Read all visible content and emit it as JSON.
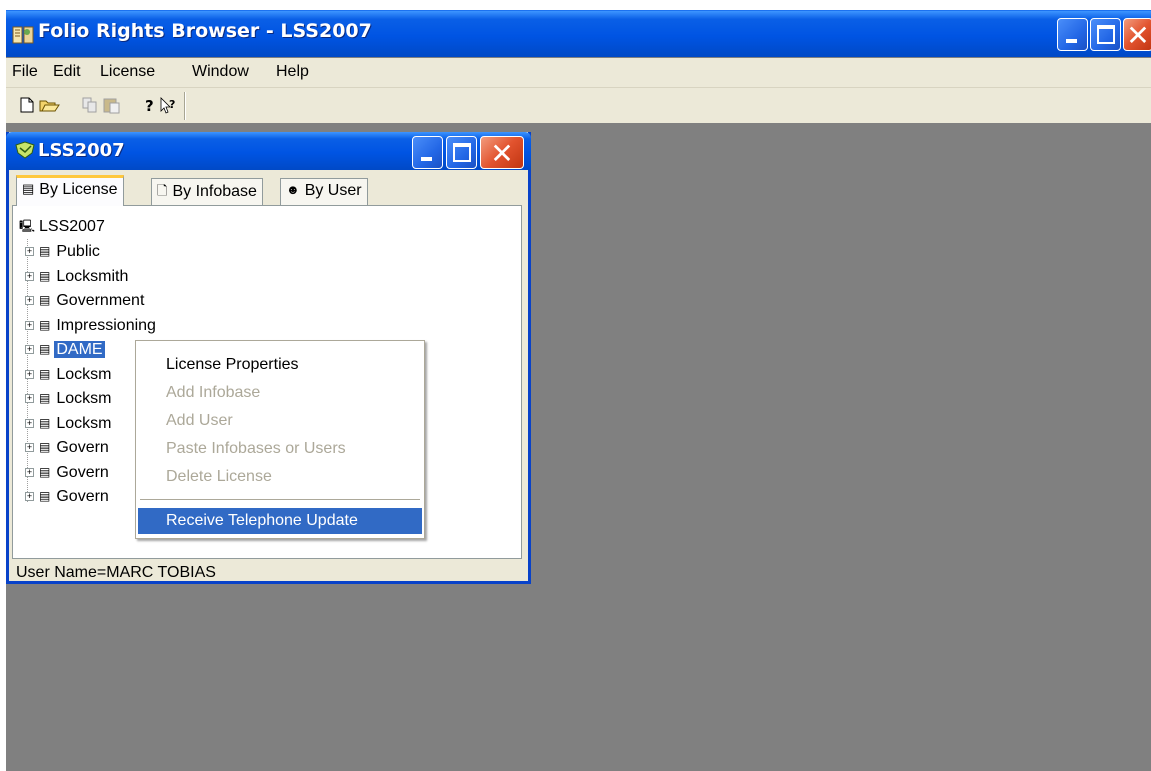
{
  "window": {
    "title": "Folio Rights Browser - LSS2007"
  },
  "menubar": {
    "items": [
      "File",
      "Edit",
      "License",
      "Window",
      "Help"
    ]
  },
  "toolbar": {
    "buttons": [
      "new-icon",
      "open-icon",
      "copy-icon",
      "paste-icon",
      "help-icon",
      "context-help-icon"
    ]
  },
  "child_window": {
    "title": "LSS2007",
    "tabs": [
      {
        "label": "By License",
        "active": true
      },
      {
        "label": "By Infobase",
        "active": false
      },
      {
        "label": "By User",
        "active": false
      }
    ],
    "tree": {
      "root": "LSS2007",
      "items": [
        {
          "label": "Public"
        },
        {
          "label": "Locksmith"
        },
        {
          "label": "Government"
        },
        {
          "label": "Impressioning"
        },
        {
          "label": "DAME",
          "selected": true
        },
        {
          "label": "Locksm"
        },
        {
          "label": "Locksm"
        },
        {
          "label": "Locksm"
        },
        {
          "label": "Govern"
        },
        {
          "label": "Govern"
        },
        {
          "label": "Govern"
        }
      ]
    },
    "status": "User Name=MARC TOBIAS"
  },
  "context_menu": {
    "items": [
      {
        "label": "License Properties",
        "enabled": true
      },
      {
        "label": "Add Infobase",
        "enabled": false
      },
      {
        "label": "Add User",
        "enabled": false
      },
      {
        "label": "Paste Infobases or Users",
        "enabled": false
      },
      {
        "label": "Delete License",
        "enabled": false
      },
      {
        "label": "Receive Telephone Update",
        "enabled": true,
        "highlighted": true
      }
    ]
  },
  "colors": {
    "titlebar": "#0054e3",
    "workspace": "#808080",
    "selection": "#316ac5",
    "disabled_text": "#aca899"
  }
}
